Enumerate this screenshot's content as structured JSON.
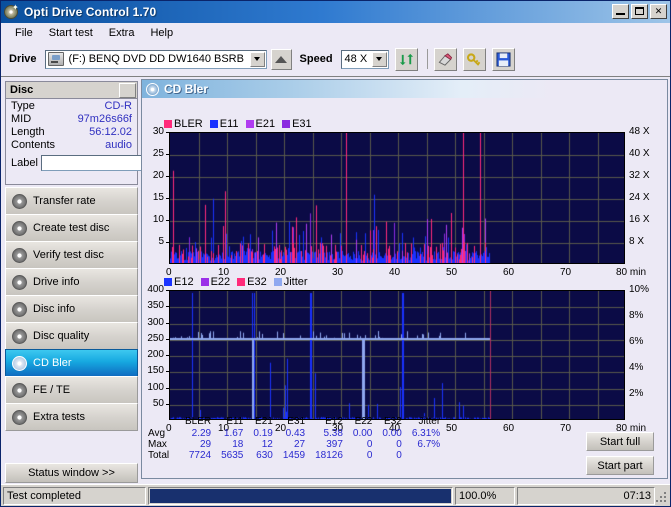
{
  "window": {
    "title": "Opti Drive Control 1.70",
    "icon": "disc-icon",
    "minimize": "_",
    "maximize": "□",
    "close": "✕"
  },
  "menu": {
    "items": [
      {
        "label": "File"
      },
      {
        "label": "Start test"
      },
      {
        "label": "Extra"
      },
      {
        "label": "Help"
      }
    ]
  },
  "toolbar": {
    "drive_label": "Drive",
    "drive_value": "(F:)   BENQ DVD DD DW1640 BSRB",
    "eject_icon": "eject-icon",
    "speed_label": "Speed",
    "speed_value": "48 X",
    "refresh_icon": "refresh-icon",
    "erase_icon": "eraser-icon",
    "key_icon": "key-icon",
    "save_icon": "save-icon"
  },
  "disc": {
    "header": "Disc",
    "rows": [
      {
        "key": "Type",
        "value": "CD-R"
      },
      {
        "key": "MID",
        "value": "97m26s66f"
      },
      {
        "key": "Length",
        "value": "56:12.02"
      },
      {
        "key": "Contents",
        "value": "audio"
      }
    ],
    "label_key": "Label",
    "label_value": "",
    "label_placeholder": "",
    "label_button_icon": "disc-refresh-icon"
  },
  "sidebar": {
    "items": [
      {
        "label": "Transfer rate",
        "icon": "disc-rate-icon",
        "active": false
      },
      {
        "label": "Create test disc",
        "icon": "disc-write-icon",
        "active": false
      },
      {
        "label": "Verify test disc",
        "icon": "disc-verify-icon",
        "active": false
      },
      {
        "label": "Drive info",
        "icon": "disc-drive-icon",
        "active": false
      },
      {
        "label": "Disc info",
        "icon": "disc-info-icon",
        "active": false
      },
      {
        "label": "Disc quality",
        "icon": "disc-quality-icon",
        "active": false
      },
      {
        "label": "CD Bler",
        "icon": "disc-bler-icon",
        "active": true
      },
      {
        "label": "FE / TE",
        "icon": "disc-fete-icon",
        "active": false
      },
      {
        "label": "Extra tests",
        "icon": "disc-extra-icon",
        "active": false
      }
    ],
    "status_window_button": "Status window >>"
  },
  "panel": {
    "title": "CD Bler",
    "icon": "disc-bler-icon",
    "start_full": "Start full",
    "start_part": "Start part"
  },
  "stats": {
    "columns": [
      "BLER",
      "E11",
      "E21",
      "E31",
      "E12",
      "E22",
      "E32",
      "Jitter"
    ],
    "rows": [
      {
        "label": "Avg",
        "values": [
          "2.29",
          "1.67",
          "0.19",
          "0.43",
          "5.38",
          "0.00",
          "0.00",
          "6.31%"
        ]
      },
      {
        "label": "Max",
        "values": [
          "29",
          "18",
          "12",
          "27",
          "397",
          "0",
          "0",
          "6.7%"
        ]
      },
      {
        "label": "Total",
        "values": [
          "7724",
          "5635",
          "630",
          "1459",
          "18126",
          "0",
          "0",
          ""
        ]
      }
    ]
  },
  "statusbar": {
    "message": "Test completed",
    "progress_percent": 100,
    "progress_text": "100.0%",
    "elapsed": "07:13"
  },
  "colors": {
    "bler": "#ff2a7a",
    "e11": "#1a32ff",
    "e21": "#b03cf0",
    "e31": "#8b2ae0",
    "e12": "#1a32ff",
    "e22": "#9b30e8",
    "e32": "#ff2a7a",
    "jitter": "#8fa8f0",
    "plot_bg": "#0b0b46",
    "grid": "#6b6b55",
    "accent": "#16a8e0"
  },
  "chart_data": [
    {
      "type": "line",
      "id": "cd-bler-top",
      "title": "CD Bler",
      "xlabel": "min",
      "ylabel": "",
      "xlim": [
        0,
        80
      ],
      "ylim": [
        0,
        30
      ],
      "xticks": [
        0,
        10,
        20,
        30,
        40,
        50,
        60,
        70,
        80
      ],
      "yticks": [
        5,
        10,
        15,
        20,
        25,
        30
      ],
      "right_axis": {
        "label": "X",
        "ticks": [
          "8 X",
          "16 X",
          "24 X",
          "32 X",
          "40 X",
          "48 X"
        ],
        "lim": [
          0,
          48
        ]
      },
      "grid": true,
      "legend_position": "top-left",
      "data_end_min": 56.2,
      "series": [
        {
          "name": "BLER",
          "color": "#ff2a7a",
          "avg": 2.29,
          "max": 29,
          "total": 7724
        },
        {
          "name": "E11",
          "color": "#1a32ff",
          "avg": 1.67,
          "max": 18,
          "total": 5635
        },
        {
          "name": "E21",
          "color": "#b03cf0",
          "avg": 0.19,
          "max": 12,
          "total": 630
        },
        {
          "name": "E31",
          "color": "#8b2ae0",
          "avg": 0.43,
          "max": 27,
          "total": 1459
        }
      ]
    },
    {
      "type": "line",
      "id": "cd-bler-bottom",
      "title": "",
      "xlabel": "min",
      "ylabel": "",
      "xlim": [
        0,
        80
      ],
      "ylim": [
        0,
        400
      ],
      "xticks": [
        0,
        10,
        20,
        30,
        40,
        50,
        60,
        70,
        80
      ],
      "yticks": [
        50,
        100,
        150,
        200,
        250,
        300,
        350,
        400
      ],
      "right_axis": {
        "label": "%",
        "ticks": [
          "2%",
          "4%",
          "6%",
          "8%",
          "10%"
        ],
        "lim": [
          0,
          10
        ]
      },
      "grid": true,
      "legend_position": "top-left",
      "data_end_min": 56.2,
      "jitter_level_percent": 6.31,
      "series": [
        {
          "name": "E12",
          "color": "#1a32ff",
          "avg": 5.38,
          "max": 397,
          "total": 18126
        },
        {
          "name": "E22",
          "color": "#9b30e8",
          "avg": 0.0,
          "max": 0,
          "total": 0
        },
        {
          "name": "E32",
          "color": "#ff2a7a",
          "avg": 0.0,
          "max": 0,
          "total": 0
        },
        {
          "name": "Jitter",
          "color": "#8fa8f0",
          "avg": 6.31,
          "max": 6.7,
          "total": null
        }
      ]
    }
  ]
}
